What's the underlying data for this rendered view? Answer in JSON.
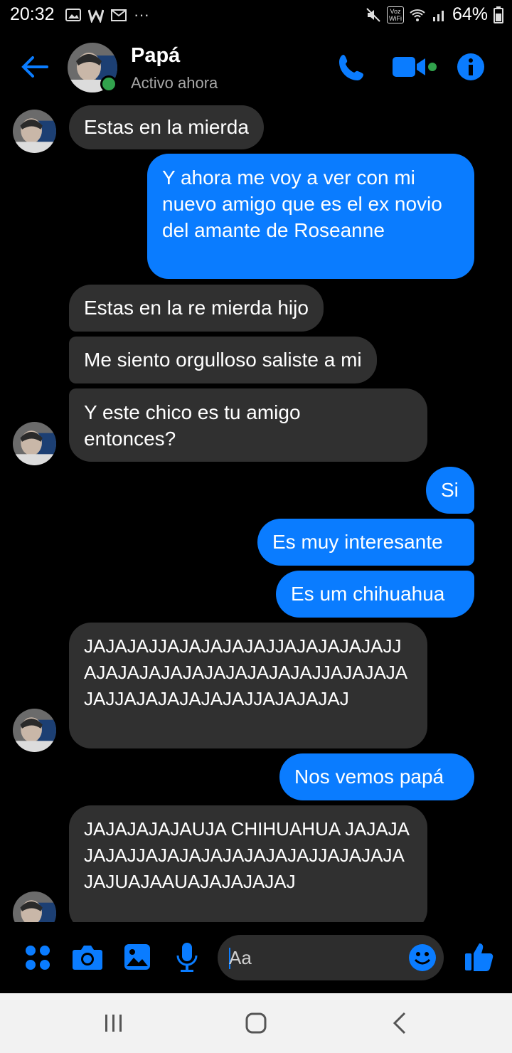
{
  "status_bar": {
    "time": "20:32",
    "battery": "64%",
    "left_icons": [
      "image-icon",
      "w-icon",
      "gmail-icon",
      "more-icon"
    ],
    "right_icons": [
      "mute-icon",
      "vowifi-icon",
      "wifi-icon",
      "signal-icon",
      "battery-icon"
    ],
    "more_text": "···",
    "vowifi_text": "Voz WiFi"
  },
  "header": {
    "name": "Papá",
    "status": "Activo ahora"
  },
  "messages": [
    {
      "dir": "in",
      "text": "Estas en la mierda"
    },
    {
      "dir": "out",
      "text": "Y ahora me voy a ver con mi nuevo amigo que es el ex novio del amante de Roseanne"
    },
    {
      "dir": "in",
      "text": "Estas en la re mierda hijo"
    },
    {
      "dir": "in",
      "text": "Me siento orgulloso saliste a mi"
    },
    {
      "dir": "in",
      "text": "Y este chico es tu amigo entonces?"
    },
    {
      "dir": "out",
      "text": "Si"
    },
    {
      "dir": "out",
      "text": "Es muy interesante"
    },
    {
      "dir": "out",
      "text": "Es um chihuahua"
    },
    {
      "dir": "in",
      "text": "JAJAJAJJAJAJAJAJAJJAJAJAJAJAJJAJAJAJAJAJAJAJAJAJAJAJJAJAJAJAJAJJAJAJAJAJAJAJJAJAJAJAJ"
    },
    {
      "dir": "out",
      "text": "Nos vemos papá"
    },
    {
      "dir": "in",
      "text": "JAJAJAJAJAUJA CHIHUAHUA JAJAJAJAJAJJAJAJAJAJAJAJAJAJJAJAJAJAJAJUAJAAUAJAJAJAJAJ"
    }
  ],
  "composer": {
    "placeholder": "Aa"
  },
  "colors": {
    "accent": "#0a7cff",
    "incoming_bubble": "#303030",
    "online": "#31a24c"
  }
}
